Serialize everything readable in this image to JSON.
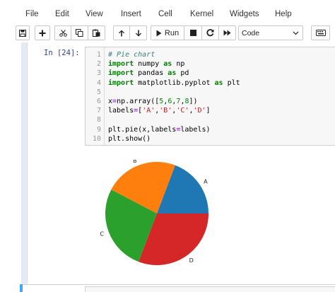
{
  "menu": {
    "items": [
      "File",
      "Edit",
      "View",
      "Insert",
      "Cell",
      "Kernel",
      "Widgets",
      "Help"
    ]
  },
  "toolbar": {
    "run_label": "Run",
    "cell_type": "Code",
    "icons": [
      "save-icon",
      "plus-icon",
      "cut-icon",
      "copy-icon",
      "paste-icon",
      "arrow-up-icon",
      "arrow-down-icon",
      "play-icon",
      "stop-icon",
      "restart-icon",
      "fast-forward-icon",
      "keyboard-icon"
    ]
  },
  "cell": {
    "prompt": "In [24]:",
    "line_numbers": [
      "1",
      "2",
      "3",
      "4",
      "5",
      "6",
      "7",
      "8",
      "9",
      "10"
    ],
    "lines": [
      "# Pie chart",
      "import numpy as np",
      "import pandas as pd",
      "import matplotlib.pyplot as plt",
      "",
      "x=np.array([5,6,7,8])",
      "labels=['A','B','C','D']",
      "",
      "plt.pie(x,labels=labels)",
      "plt.show()"
    ]
  },
  "chart_data": {
    "type": "pie",
    "categories": [
      "A",
      "B",
      "C",
      "D"
    ],
    "values": [
      5,
      6,
      7,
      8
    ],
    "colors": [
      "#1f77b4",
      "#ff7f0e",
      "#2ca02c",
      "#d62728"
    ],
    "start_angle_deg": 0,
    "direction": "counterclockwise",
    "title": ""
  }
}
